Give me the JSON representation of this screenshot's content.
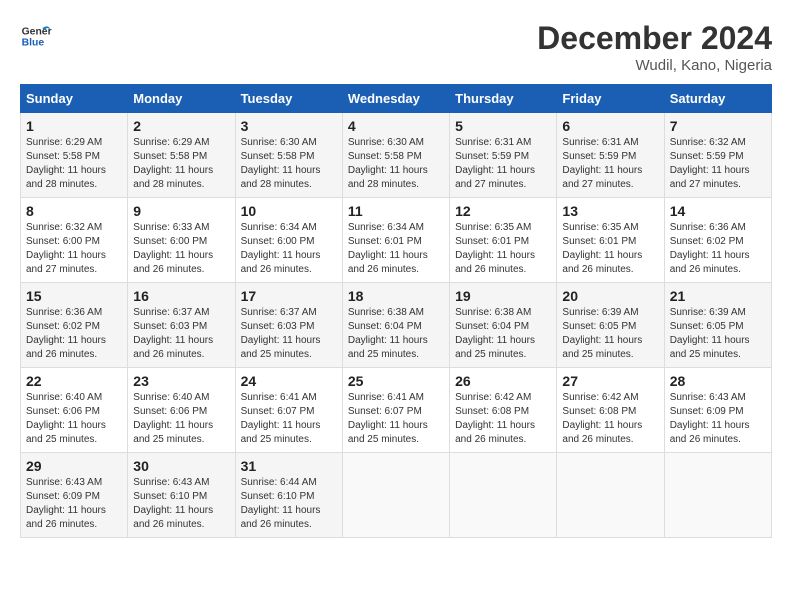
{
  "header": {
    "logo_line1": "General",
    "logo_line2": "Blue",
    "month": "December 2024",
    "location": "Wudil, Kano, Nigeria"
  },
  "weekdays": [
    "Sunday",
    "Monday",
    "Tuesday",
    "Wednesday",
    "Thursday",
    "Friday",
    "Saturday"
  ],
  "weeks": [
    [
      {
        "day": "1",
        "sunrise": "6:29 AM",
        "sunset": "5:58 PM",
        "daylight": "11 hours and 28 minutes."
      },
      {
        "day": "2",
        "sunrise": "6:29 AM",
        "sunset": "5:58 PM",
        "daylight": "11 hours and 28 minutes."
      },
      {
        "day": "3",
        "sunrise": "6:30 AM",
        "sunset": "5:58 PM",
        "daylight": "11 hours and 28 minutes."
      },
      {
        "day": "4",
        "sunrise": "6:30 AM",
        "sunset": "5:58 PM",
        "daylight": "11 hours and 28 minutes."
      },
      {
        "day": "5",
        "sunrise": "6:31 AM",
        "sunset": "5:59 PM",
        "daylight": "11 hours and 27 minutes."
      },
      {
        "day": "6",
        "sunrise": "6:31 AM",
        "sunset": "5:59 PM",
        "daylight": "11 hours and 27 minutes."
      },
      {
        "day": "7",
        "sunrise": "6:32 AM",
        "sunset": "5:59 PM",
        "daylight": "11 hours and 27 minutes."
      }
    ],
    [
      {
        "day": "8",
        "sunrise": "6:32 AM",
        "sunset": "6:00 PM",
        "daylight": "11 hours and 27 minutes."
      },
      {
        "day": "9",
        "sunrise": "6:33 AM",
        "sunset": "6:00 PM",
        "daylight": "11 hours and 26 minutes."
      },
      {
        "day": "10",
        "sunrise": "6:34 AM",
        "sunset": "6:00 PM",
        "daylight": "11 hours and 26 minutes."
      },
      {
        "day": "11",
        "sunrise": "6:34 AM",
        "sunset": "6:01 PM",
        "daylight": "11 hours and 26 minutes."
      },
      {
        "day": "12",
        "sunrise": "6:35 AM",
        "sunset": "6:01 PM",
        "daylight": "11 hours and 26 minutes."
      },
      {
        "day": "13",
        "sunrise": "6:35 AM",
        "sunset": "6:01 PM",
        "daylight": "11 hours and 26 minutes."
      },
      {
        "day": "14",
        "sunrise": "6:36 AM",
        "sunset": "6:02 PM",
        "daylight": "11 hours and 26 minutes."
      }
    ],
    [
      {
        "day": "15",
        "sunrise": "6:36 AM",
        "sunset": "6:02 PM",
        "daylight": "11 hours and 26 minutes."
      },
      {
        "day": "16",
        "sunrise": "6:37 AM",
        "sunset": "6:03 PM",
        "daylight": "11 hours and 26 minutes."
      },
      {
        "day": "17",
        "sunrise": "6:37 AM",
        "sunset": "6:03 PM",
        "daylight": "11 hours and 25 minutes."
      },
      {
        "day": "18",
        "sunrise": "6:38 AM",
        "sunset": "6:04 PM",
        "daylight": "11 hours and 25 minutes."
      },
      {
        "day": "19",
        "sunrise": "6:38 AM",
        "sunset": "6:04 PM",
        "daylight": "11 hours and 25 minutes."
      },
      {
        "day": "20",
        "sunrise": "6:39 AM",
        "sunset": "6:05 PM",
        "daylight": "11 hours and 25 minutes."
      },
      {
        "day": "21",
        "sunrise": "6:39 AM",
        "sunset": "6:05 PM",
        "daylight": "11 hours and 25 minutes."
      }
    ],
    [
      {
        "day": "22",
        "sunrise": "6:40 AM",
        "sunset": "6:06 PM",
        "daylight": "11 hours and 25 minutes."
      },
      {
        "day": "23",
        "sunrise": "6:40 AM",
        "sunset": "6:06 PM",
        "daylight": "11 hours and 25 minutes."
      },
      {
        "day": "24",
        "sunrise": "6:41 AM",
        "sunset": "6:07 PM",
        "daylight": "11 hours and 25 minutes."
      },
      {
        "day": "25",
        "sunrise": "6:41 AM",
        "sunset": "6:07 PM",
        "daylight": "11 hours and 25 minutes."
      },
      {
        "day": "26",
        "sunrise": "6:42 AM",
        "sunset": "6:08 PM",
        "daylight": "11 hours and 26 minutes."
      },
      {
        "day": "27",
        "sunrise": "6:42 AM",
        "sunset": "6:08 PM",
        "daylight": "11 hours and 26 minutes."
      },
      {
        "day": "28",
        "sunrise": "6:43 AM",
        "sunset": "6:09 PM",
        "daylight": "11 hours and 26 minutes."
      }
    ],
    [
      {
        "day": "29",
        "sunrise": "6:43 AM",
        "sunset": "6:09 PM",
        "daylight": "11 hours and 26 minutes."
      },
      {
        "day": "30",
        "sunrise": "6:43 AM",
        "sunset": "6:10 PM",
        "daylight": "11 hours and 26 minutes."
      },
      {
        "day": "31",
        "sunrise": "6:44 AM",
        "sunset": "6:10 PM",
        "daylight": "11 hours and 26 minutes."
      },
      null,
      null,
      null,
      null
    ]
  ]
}
